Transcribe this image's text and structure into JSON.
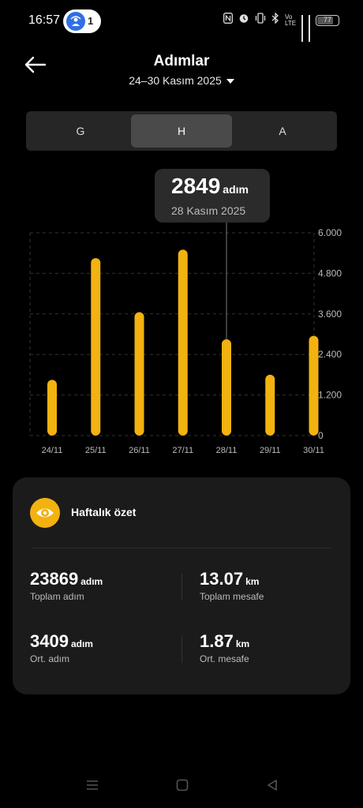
{
  "status_bar": {
    "time": "16:57",
    "notification_count": "1",
    "battery": "77",
    "net_label": "Vo LTE"
  },
  "header": {
    "title": "Adımlar",
    "period": "24–30 Kasım 2025"
  },
  "segments": [
    {
      "label": "G",
      "selected": false
    },
    {
      "label": "H",
      "selected": true
    },
    {
      "label": "A",
      "selected": false
    }
  ],
  "tooltip": {
    "value": "2849",
    "unit": "adım",
    "date": "28 Kasım 2025"
  },
  "chart_data": {
    "type": "bar",
    "categories": [
      "24/11",
      "25/11",
      "26/11",
      "27/11",
      "28/11",
      "29/11",
      "30/11"
    ],
    "values": [
      1650,
      5250,
      3650,
      5500,
      2849,
      1800,
      2950
    ],
    "yticks": [
      "6.000",
      "4.800",
      "3.600",
      "2.400",
      "1.200",
      "0"
    ],
    "ylim": [
      0,
      6000
    ],
    "selected_index": 4,
    "bar_color": "#f2b20f",
    "grid": true
  },
  "summary": {
    "title": "Haftalık özet",
    "stats": [
      {
        "value": "23869",
        "unit": "adım",
        "label": "Toplam adım"
      },
      {
        "value": "13.07",
        "unit": "km",
        "label": "Toplam mesafe"
      },
      {
        "value": "3409",
        "unit": "adım",
        "label": "Ort. adım"
      },
      {
        "value": "1.87",
        "unit": "km",
        "label": "Ort. mesafe"
      }
    ]
  },
  "colors": {
    "accent": "#f2b20f",
    "background": "#000000",
    "card": "#1b1b1b"
  },
  "icons": [
    "back-arrow-icon",
    "dropdown-caret-icon",
    "eye-icon",
    "menu-nav-icon",
    "home-nav-icon",
    "back-nav-icon"
  ]
}
